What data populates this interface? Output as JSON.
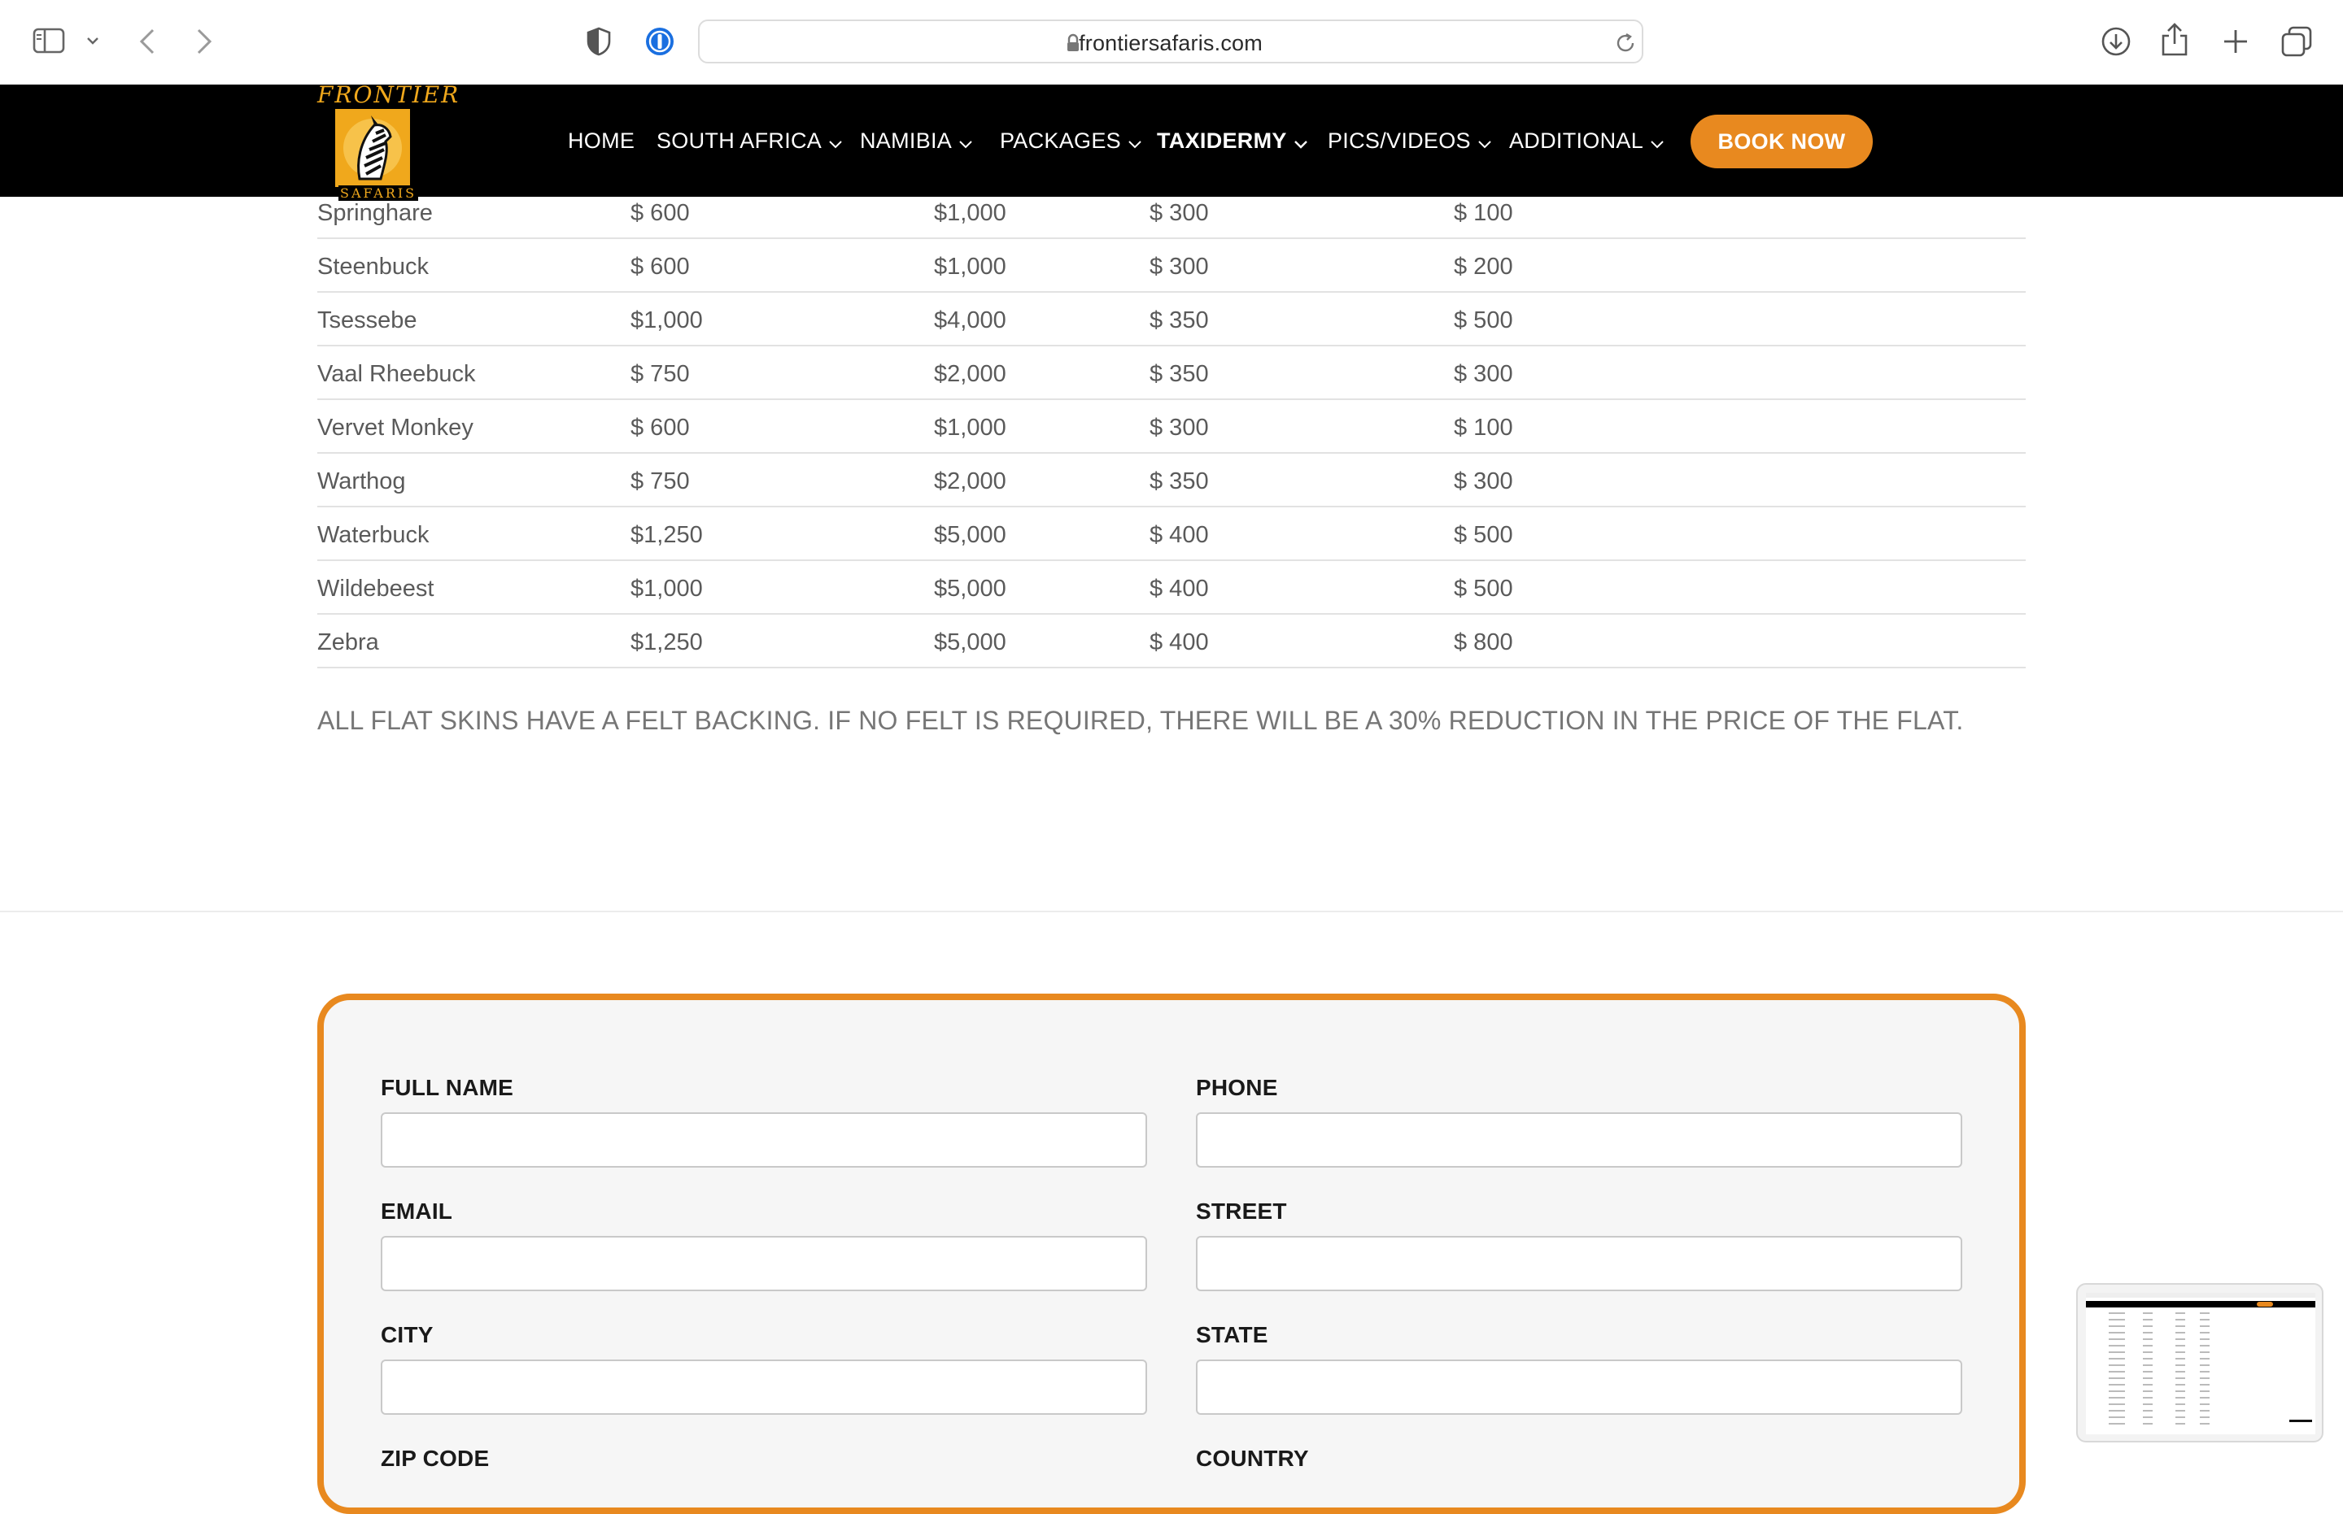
{
  "browser": {
    "url": "frontiersafaris.com",
    "icons": {
      "sidebar": "sidebar-icon",
      "chevron": "chevron-down-icon",
      "back": "back-arrow-icon",
      "forward": "forward-arrow-icon",
      "privacy": "shield-icon",
      "password": "password-manager-icon",
      "reload": "reload-icon",
      "download": "download-icon",
      "share": "share-icon",
      "new_tab": "plus-icon",
      "tabs": "tab-overview-icon"
    }
  },
  "header": {
    "logo_top": "FRONTIER",
    "logo_bottom": "SAFARIS",
    "nav": [
      "HOME",
      "SOUTH AFRICA",
      "NAMIBIA",
      "PACKAGES",
      "TAXIDERMY",
      "PICS/VIDEOS",
      "ADDITIONAL"
    ],
    "active_nav": "TAXIDERMY",
    "cta": "BOOK NOW",
    "colors": {
      "accent": "#e8891f",
      "header_bg": "#000000",
      "logo": "#f0a81c"
    }
  },
  "table": {
    "rows": [
      [
        "Springhare",
        "$ 600",
        "$1,000",
        "$ 300",
        "$ 100"
      ],
      [
        "Steenbuck",
        "$ 600",
        "$1,000",
        "$ 300",
        "$ 200"
      ],
      [
        "Tsessebe",
        "$1,000",
        "$4,000",
        "$ 350",
        "$ 500"
      ],
      [
        "Vaal Rheebuck",
        "$ 750",
        "$2,000",
        "$ 350",
        "$ 300"
      ],
      [
        "Vervet Monkey",
        "$ 600",
        "$1,000",
        "$ 300",
        "$ 100"
      ],
      [
        "Warthog",
        "$ 750",
        "$2,000",
        "$ 350",
        "$ 300"
      ],
      [
        "Waterbuck",
        "$1,250",
        "$5,000",
        "$ 400",
        "$ 500"
      ],
      [
        "Wildebeest",
        "$1,000",
        "$5,000",
        "$ 400",
        "$ 500"
      ],
      [
        "Zebra",
        "$1,250",
        "$5,000",
        "$ 400",
        "$ 800"
      ]
    ],
    "note": "ALL FLAT SKINS HAVE A FELT BACKING. IF NO FELT IS REQUIRED, THERE WILL BE A 30% REDUCTION IN THE PRICE OF THE FLAT."
  },
  "form": {
    "fields": {
      "full_name": "FULL NAME",
      "phone": "PHONE",
      "email": "EMAIL",
      "street": "STREET",
      "city": "CITY",
      "state": "STATE",
      "zip": "ZIP CODE",
      "country": "COUNTRY"
    },
    "values": {
      "full_name": "",
      "phone": "",
      "email": "",
      "street": "",
      "city": "",
      "state": ""
    }
  }
}
